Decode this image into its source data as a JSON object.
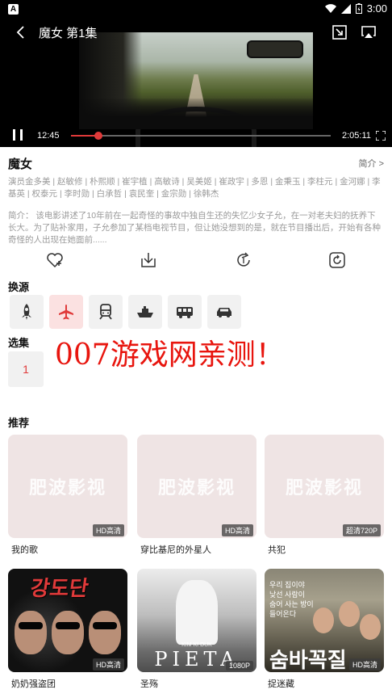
{
  "status_bar": {
    "app_badge": "A",
    "time": "3:00"
  },
  "player": {
    "title": "魔女 第1集",
    "current_time": "12:45",
    "total_time": "2:05:11",
    "progress": 0.105
  },
  "movie": {
    "title": "魔女",
    "intro_link": "简介 >",
    "cast": "演员金多美 | 赵敏修 | 朴熙顺 | 崔宇植 | 高敏诗 | 吴美姬 | 崔政宇 | 多恩 | 金秉玉 | 李柱元 | 金河娜 | 李基英 | 权泰元 | 李时勋 | 白承哲 | 袁民奎 | 金宗勋 | 徐韩杰",
    "synopsis": "简介：  该电影讲述了10年前在一起奇怪的事故中独自生还的失忆少女子允，在一对老夫妇的抚养下长大。为了贴补家用，子允参加了某档电视节目，但让她没想到的是，就在节目播出后，开始有各种奇怪的人出现在她面前......"
  },
  "actions": [
    {
      "icon": "favorite-add-icon"
    },
    {
      "icon": "download-icon"
    },
    {
      "icon": "refresh-icon"
    },
    {
      "icon": "screen-icon"
    }
  ],
  "sources": {
    "label": "换源",
    "items": [
      {
        "icon": "rocket-icon",
        "active": false
      },
      {
        "icon": "airplane-icon",
        "active": true
      },
      {
        "icon": "train-icon",
        "active": false
      },
      {
        "icon": "ship-icon",
        "active": false
      },
      {
        "icon": "bus-icon",
        "active": false
      },
      {
        "icon": "car-icon",
        "active": false
      }
    ]
  },
  "episodes": {
    "label": "选集",
    "items": [
      "1"
    ]
  },
  "watermark": "007游戏网亲测！",
  "recommend": {
    "label": "推荐",
    "placeholder_text": "肥波影视",
    "items": [
      {
        "title": "我的歌",
        "badge": "HD高清",
        "has_image": false
      },
      {
        "title": "穿比基尼的外星人",
        "badge": "HD高清",
        "has_image": false
      },
      {
        "title": "共犯",
        "badge": "超清720P",
        "has_image": false
      },
      {
        "title": "奶奶强盗团",
        "badge": "HD高清",
        "has_image": true,
        "poster_text": "강도단"
      },
      {
        "title": "圣殇",
        "badge": "1080P",
        "has_image": true,
        "poster_text": "PIETA",
        "poster_sub": "KIM KI DUK"
      },
      {
        "title": "捉迷藏",
        "badge": "HD高清",
        "has_image": true,
        "poster_text": "숨바꼭질",
        "poster_sub": "우리 집이야\n낯선 사람이\n숨어 사는 방이\n들어온다"
      }
    ]
  },
  "colors": {
    "accent": "#e03a3a",
    "active_bg": "#fbe1e1",
    "tile_bg": "#f1f1f1",
    "watermark": "#e8150e"
  }
}
